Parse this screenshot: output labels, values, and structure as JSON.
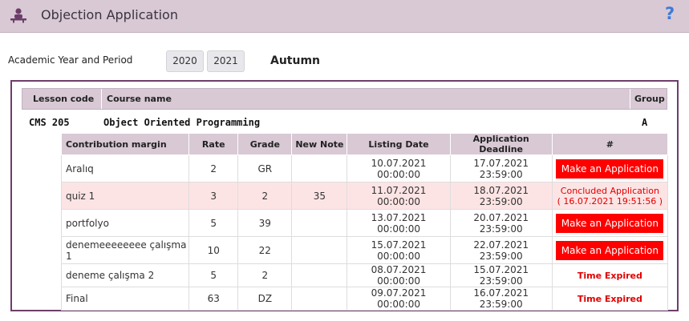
{
  "header": {
    "title": "Objection Application",
    "help_label": "?"
  },
  "period": {
    "label": "Academic Year and Period",
    "years": [
      "2020",
      "2021"
    ],
    "term": "Autumn"
  },
  "course_table": {
    "headers": {
      "code": "Lesson code",
      "name": "Course name",
      "group": "Group"
    },
    "course": {
      "code": "CMS 205",
      "name": "Object Oriented Programming",
      "group": "A"
    }
  },
  "grades_table": {
    "headers": [
      "Contribution margin",
      "Rate",
      "Grade",
      "New Note",
      "Listing Date",
      "Application Deadline",
      "#"
    ],
    "rows": [
      {
        "margin": "Aralıq",
        "rate": "2",
        "grade": "GR",
        "new_note": "",
        "listing": "10.07.2021 00:00:00",
        "deadline": "17.07.2021 23:59:00",
        "action_type": "button",
        "action": "Make an Application",
        "action2": ""
      },
      {
        "margin": "quiz 1",
        "rate": "3",
        "grade": "2",
        "new_note": "35",
        "listing": "11.07.2021 00:00:00",
        "deadline": "18.07.2021 23:59:00",
        "action_type": "concluded",
        "action": "Concluded Application",
        "action2": "( 16.07.2021 19:51:56 )"
      },
      {
        "margin": "portfolyo",
        "rate": "5",
        "grade": "39",
        "new_note": "",
        "listing": "13.07.2021 00:00:00",
        "deadline": "20.07.2021 23:59:00",
        "action_type": "button",
        "action": "Make an Application",
        "action2": ""
      },
      {
        "margin": "denemeeeeeeee çalışma 1",
        "rate": "10",
        "grade": "22",
        "new_note": "",
        "listing": "15.07.2021 00:00:00",
        "deadline": "22.07.2021 23:59:00",
        "action_type": "button",
        "action": "Make an Application",
        "action2": ""
      },
      {
        "margin": "deneme çalışma 2",
        "rate": "5",
        "grade": "2",
        "new_note": "",
        "listing": "08.07.2021 00:00:00",
        "deadline": "15.07.2021 23:59:00",
        "action_type": "expired",
        "action": "Time Expired",
        "action2": ""
      },
      {
        "margin": "Final",
        "rate": "63",
        "grade": "DZ",
        "new_note": "",
        "listing": "09.07.2021 00:00:00",
        "deadline": "16.07.2021 23:59:00",
        "action_type": "expired",
        "action": "Time Expired",
        "action2": ""
      }
    ]
  },
  "colors": {
    "header_bg": "#d8c9d5",
    "panel_border": "#6d3e6a",
    "apply_button": "#ff0000",
    "highlight_row": "#fde4e4",
    "help_icon": "#3d7bd9"
  },
  "icons": {
    "header": "objection-person-icon",
    "help": "help-icon"
  }
}
